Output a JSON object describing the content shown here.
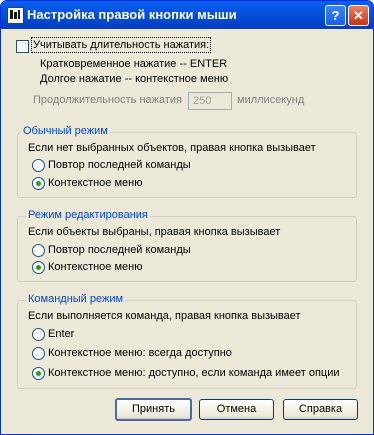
{
  "window": {
    "title": "Настройка правой кнопки мыши",
    "help_button": "?",
    "close_button": "✕"
  },
  "long_click": {
    "checkbox_label": "Учитывать длительность нажатия:",
    "checked": false,
    "short_line": "Кратковременное нажатие -- ENTER",
    "long_line": "Долгое нажатие -- контекстное меню",
    "duration_label": "Продолжительность нажатия",
    "duration_value": "250",
    "duration_unit": "миллисекунд"
  },
  "normal_mode": {
    "title": "Обычный режим",
    "description": "Если нет выбранных объектов, правая кнопка вызывает",
    "options": [
      "Повтор последней команды",
      "Контекстное меню"
    ],
    "selected": 1
  },
  "edit_mode": {
    "title": "Режим редактирования",
    "description": "Если объекты выбраны, правая кнопка вызывает",
    "options": [
      "Повтор последней команды",
      "Контекстное меню"
    ],
    "selected": 1
  },
  "command_mode": {
    "title": "Командный режим",
    "description": "Если выполняется команда, правая кнопка вызывает",
    "options": [
      "Enter",
      "Контекстное меню: всегда доступно",
      "Контекстное меню: доступно, если команда имеет опции"
    ],
    "selected": 2
  },
  "buttons": {
    "ok": "Принять",
    "cancel": "Отмена",
    "help": "Справка"
  },
  "colors": {
    "titlebar": "#0553e0",
    "dialog_bg": "#ece9d8",
    "group_title": "#0046d5",
    "radio_dot": "#21a121"
  }
}
